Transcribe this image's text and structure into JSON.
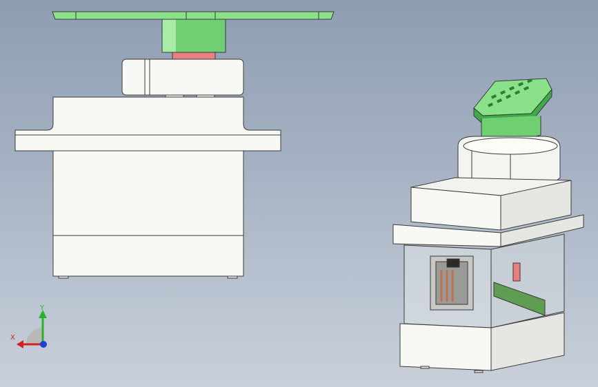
{
  "viewport": {
    "background_top": "#8e9db2",
    "background_bottom": "#c9d0da"
  },
  "colors": {
    "horn_green": "#8be08a",
    "horn_green_dark": "#3faa48",
    "shaft_red": "#e88080",
    "body_white": "#f8f8f4",
    "edge": "#3a3a3a",
    "pcb_green": "#5f9e52",
    "axis_x": "#d42020",
    "axis_y": "#28b428",
    "axis_z": "#2040d0"
  },
  "models": {
    "front_view_name": "servo-front-view",
    "iso_view_name": "servo-isometric-view"
  },
  "triad": {
    "x_label": "X",
    "y_label": "Y"
  }
}
